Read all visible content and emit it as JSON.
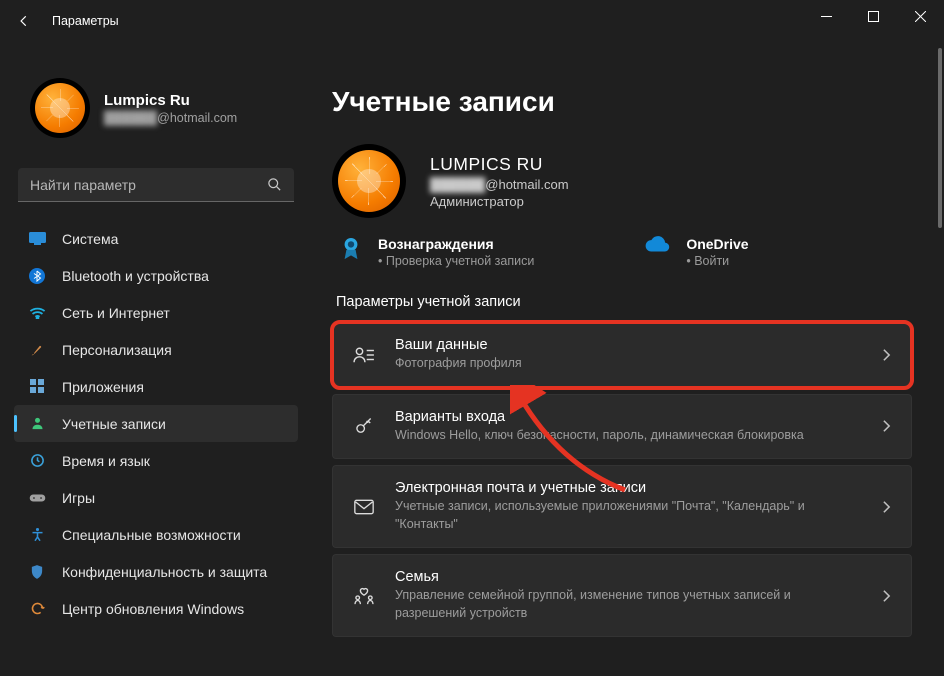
{
  "window": {
    "title": "Параметры"
  },
  "user": {
    "name": "Lumpics Ru",
    "email_masked": "██████",
    "email_suffix": "@hotmail.com"
  },
  "search": {
    "placeholder": "Найти параметр"
  },
  "nav": [
    {
      "key": "system",
      "label": "Система"
    },
    {
      "key": "bluetooth",
      "label": "Bluetooth и устройства"
    },
    {
      "key": "network",
      "label": "Сеть и Интернет"
    },
    {
      "key": "personalization",
      "label": "Персонализация"
    },
    {
      "key": "apps",
      "label": "Приложения"
    },
    {
      "key": "accounts",
      "label": "Учетные записи"
    },
    {
      "key": "time",
      "label": "Время и язык"
    },
    {
      "key": "gaming",
      "label": "Игры"
    },
    {
      "key": "accessibility",
      "label": "Специальные возможности"
    },
    {
      "key": "privacy",
      "label": "Конфиденциальность и защита"
    },
    {
      "key": "update",
      "label": "Центр обновления Windows"
    }
  ],
  "page": {
    "title": "Учетные записи",
    "account_name": "LUMPICS RU",
    "account_email_masked": "██████",
    "account_email_suffix": "@hotmail.com",
    "account_role": "Администратор",
    "tiles": {
      "rewards": {
        "label": "Вознаграждения",
        "sub": "Проверка учетной записи"
      },
      "onedrive": {
        "label": "OneDrive",
        "sub": "Войти"
      }
    },
    "section_title": "Параметры учетной записи",
    "cards": [
      {
        "key": "your-info",
        "title": "Ваши данные",
        "desc": "Фотография профиля"
      },
      {
        "key": "signin",
        "title": "Варианты входа",
        "desc": "Windows Hello, ключ безопасности, пароль, динамическая блокировка"
      },
      {
        "key": "email",
        "title": "Электронная почта и учетные записи",
        "desc": "Учетные записи, используемые приложениями \"Почта\", \"Календарь\" и \"Контакты\""
      },
      {
        "key": "family",
        "title": "Семья",
        "desc": "Управление семейной группой, изменение типов учетных записей и разрешений устройств"
      }
    ]
  },
  "icons": {
    "back": "←",
    "minimize": "—",
    "maximize": "▢",
    "close": "✕",
    "glass": "⌕",
    "chevron": "›"
  }
}
